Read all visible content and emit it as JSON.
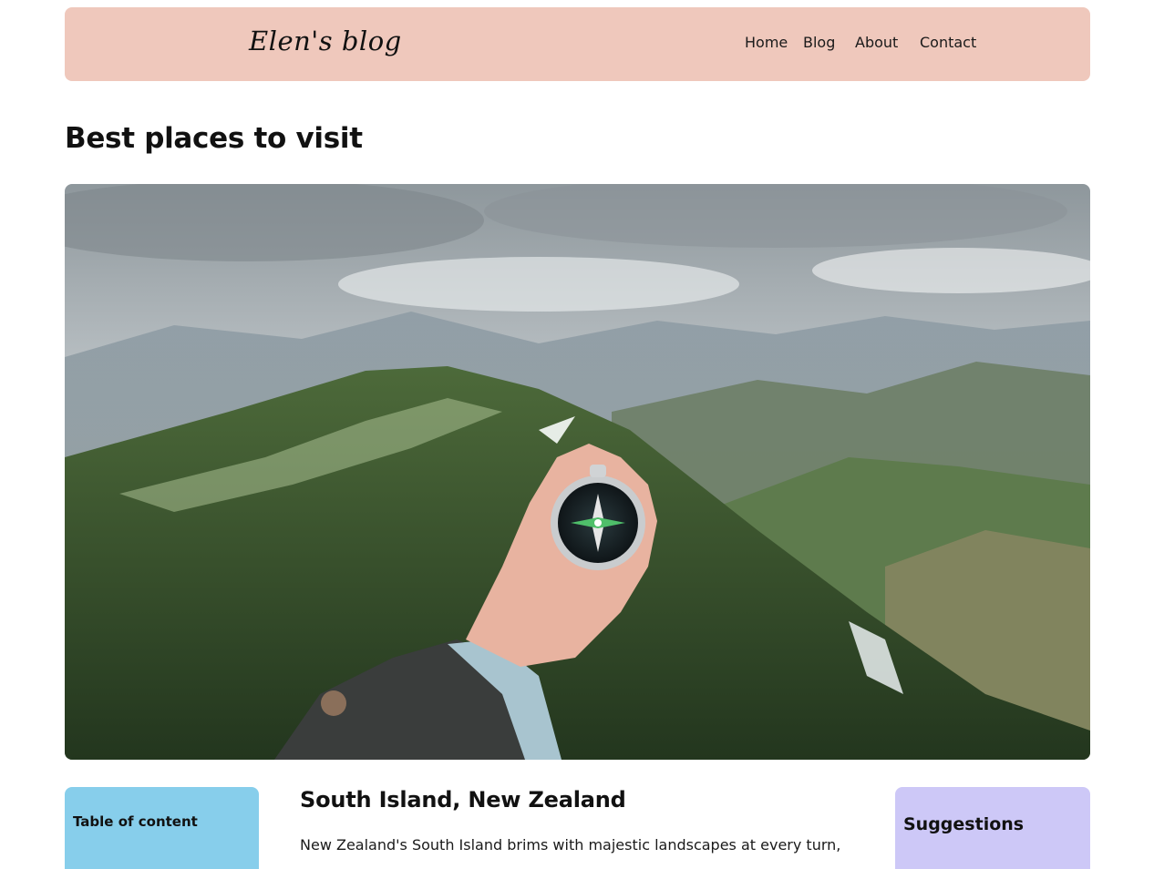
{
  "header": {
    "logo": "Elen's blog",
    "nav": [
      {
        "label": "Home"
      },
      {
        "label": "Blog"
      },
      {
        "label": "About"
      },
      {
        "label": "Contact"
      }
    ]
  },
  "main": {
    "page_title": "Best places to visit",
    "hero_image": "mountain-compass-photo"
  },
  "toc": {
    "title": "Table of content"
  },
  "article": {
    "title": "South Island, New Zealand",
    "intro": "New Zealand's South Island brims with majestic landscapes at every turn,"
  },
  "suggestions": {
    "title": "Suggestions"
  },
  "colors": {
    "header_bg": "#efc8bc",
    "toc_bg": "#87ceeb",
    "suggestions_bg": "#cdc8f7"
  }
}
